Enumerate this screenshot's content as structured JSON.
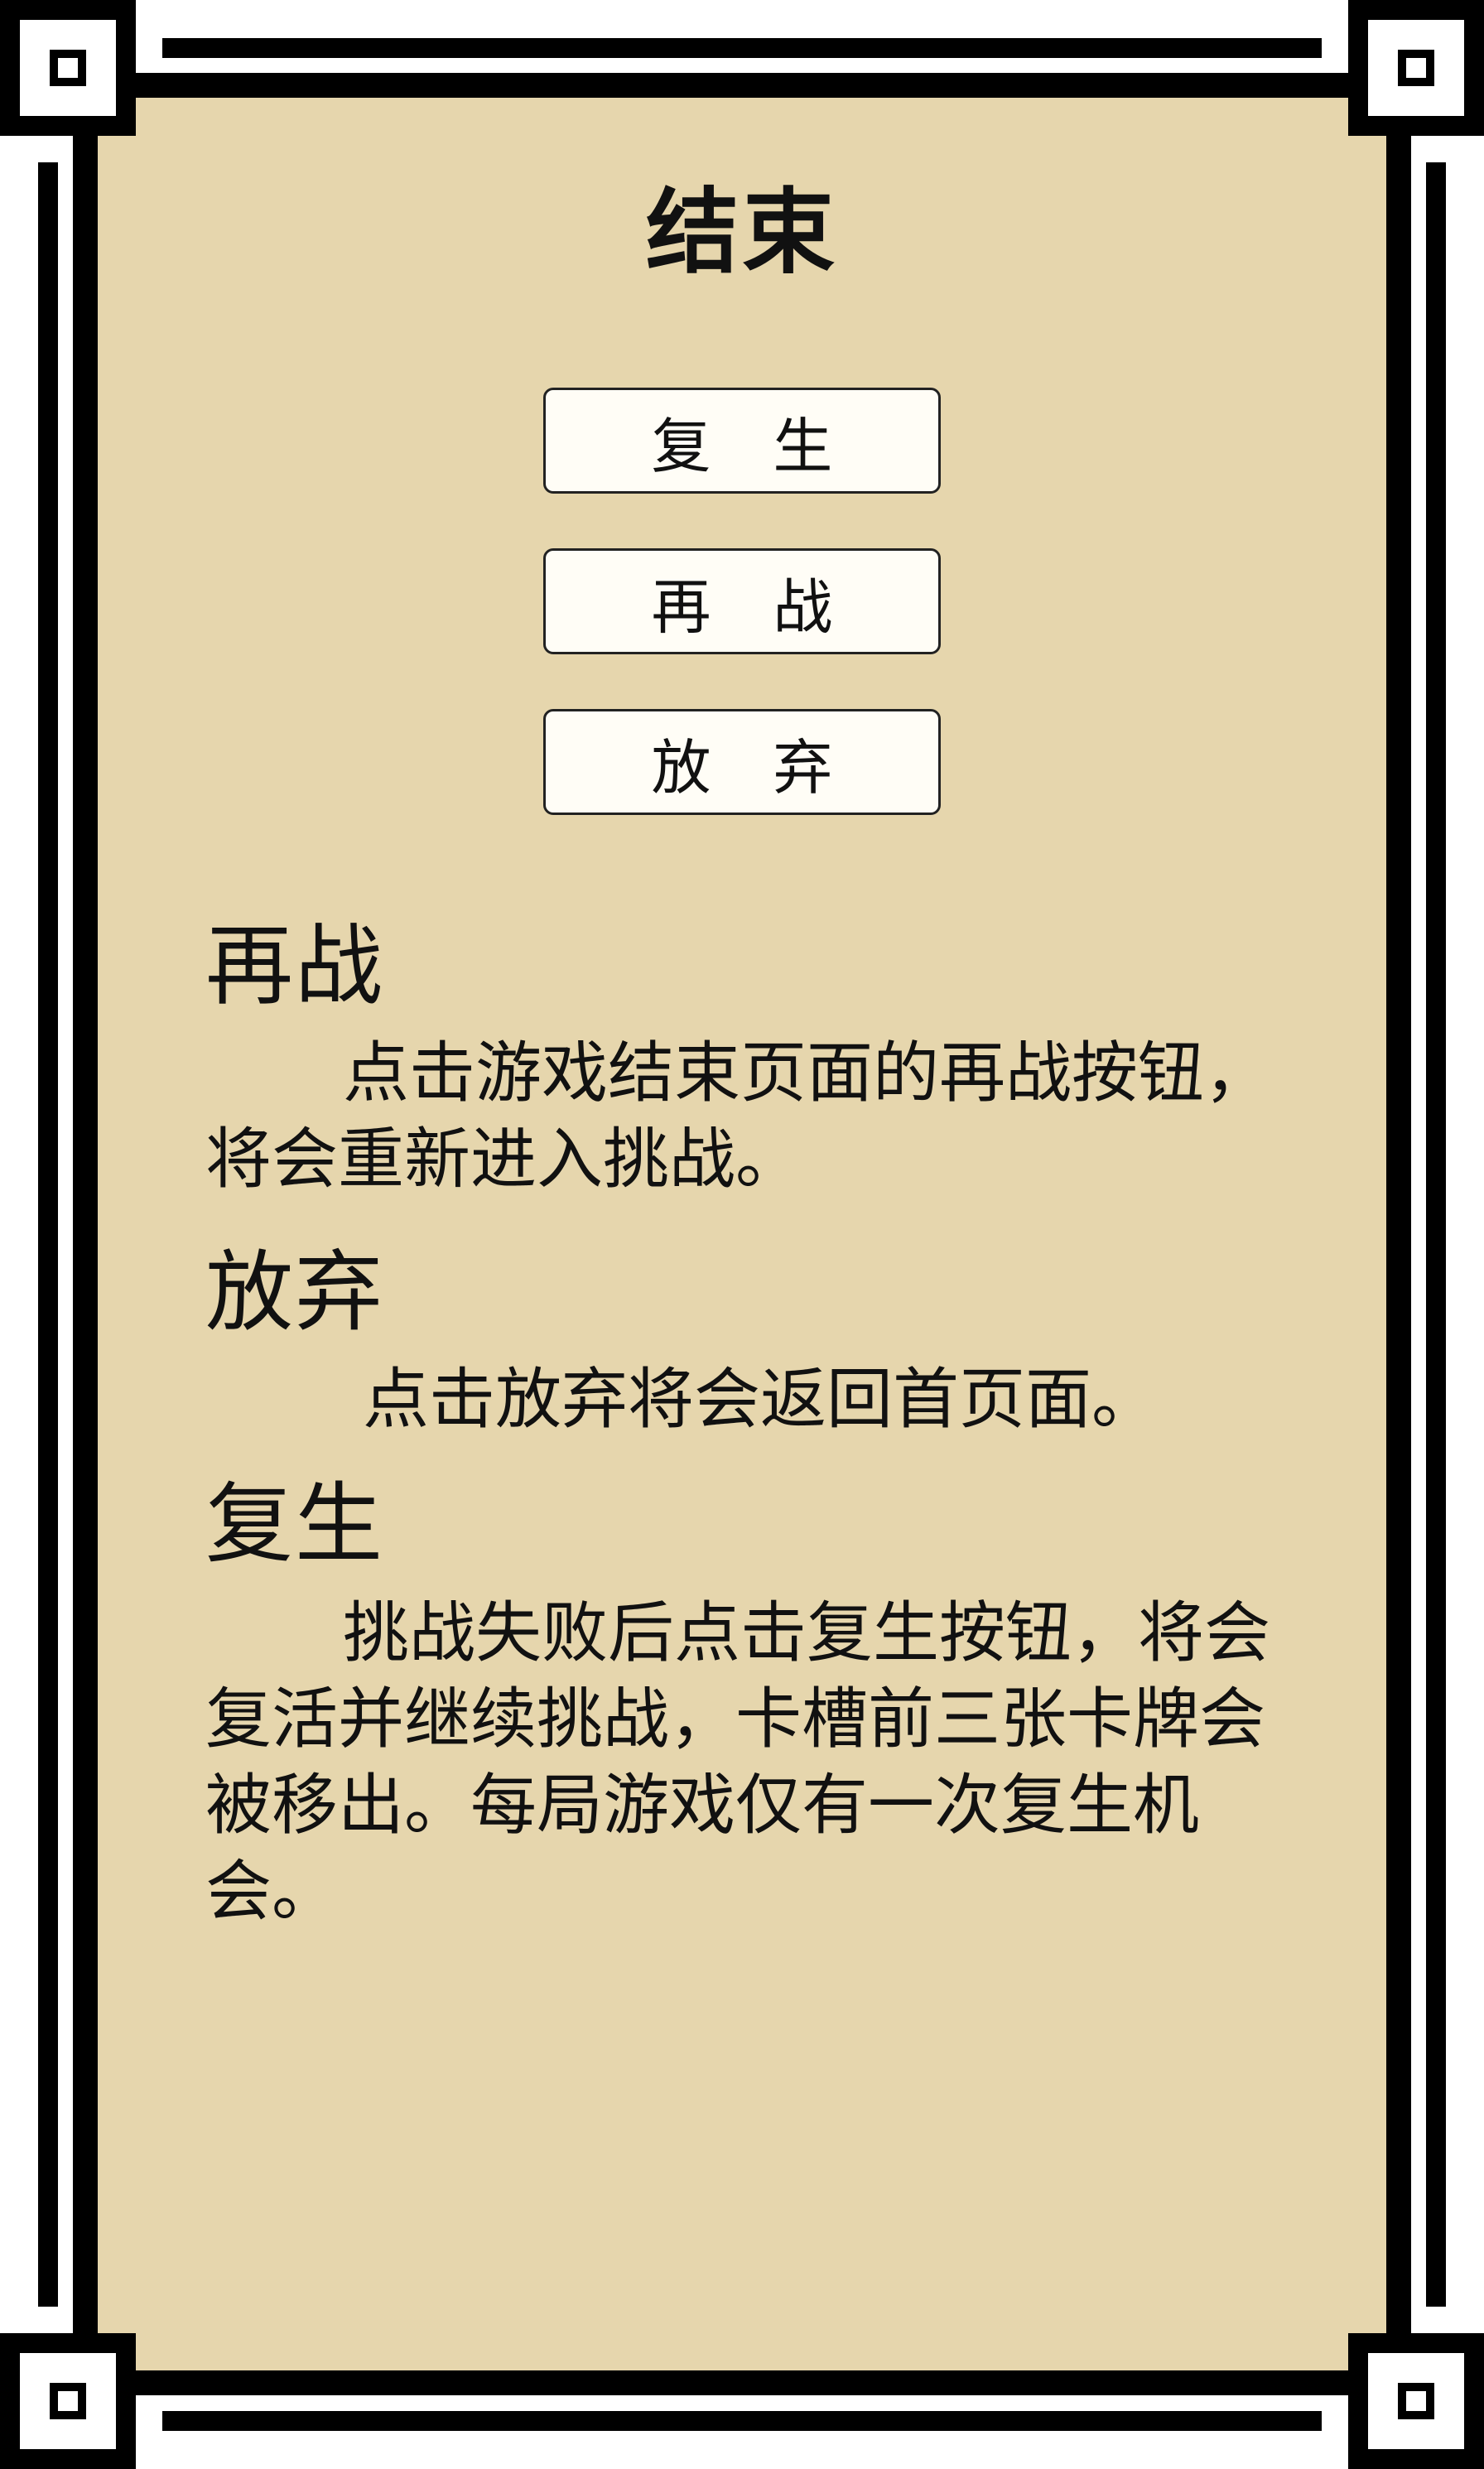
{
  "title": "结束",
  "buttons": {
    "revive": "复 生",
    "retry": "再 战",
    "abandon": "放 弃"
  },
  "sections": [
    {
      "heading": "再战",
      "body": "点击游戏结束页面的再战按钮，将会重新进入挑战。"
    },
    {
      "heading": "放弃",
      "body": "点击放弃将会返回首页面。"
    },
    {
      "heading": "复生",
      "body": "挑战失败后点击复生按钮，将会复活并继续挑战，卡槽前三张卡牌会被移出。每局游戏仅有一次复生机会。"
    }
  ],
  "colors": {
    "panel": "#e6d6ad",
    "border": "#000000",
    "button_bg": "#fffdf6"
  }
}
